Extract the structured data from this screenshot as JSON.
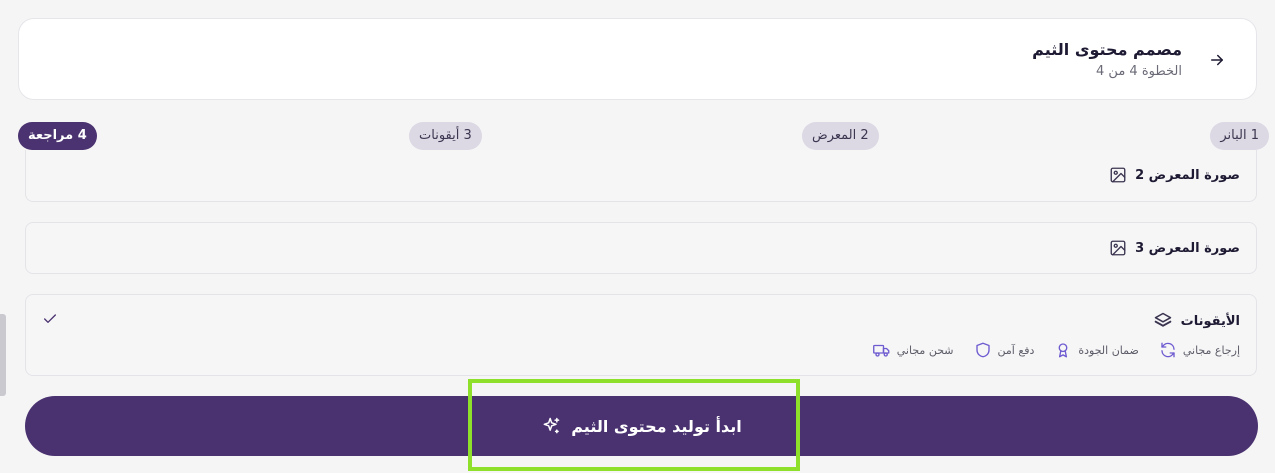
{
  "header": {
    "title": "مصمم محتوى الثيم",
    "step_text": "الخطوة 4 من 4"
  },
  "stepper": {
    "steps": [
      {
        "label": "1 البانر",
        "active": false
      },
      {
        "label": "2 المعرض",
        "active": false
      },
      {
        "label": "3 أيقونات",
        "active": false
      },
      {
        "label": "4 مراجعة",
        "active": true
      }
    ]
  },
  "sections": {
    "gallery_2": {
      "title": "صورة المعرض 2",
      "icon": "image-icon"
    },
    "gallery_3": {
      "title": "صورة المعرض 3",
      "icon": "image-icon"
    },
    "icons": {
      "title": "الأيقونات",
      "icon": "layers-icon",
      "status_icon": "check-icon",
      "features": [
        {
          "label": "شحن مجاني",
          "icon": "truck-icon"
        },
        {
          "label": "دفع آمن",
          "icon": "shield-icon"
        },
        {
          "label": "ضمان الجودة",
          "icon": "award-icon"
        },
        {
          "label": "إرجاع مجاني",
          "icon": "refresh-icon"
        }
      ]
    }
  },
  "generate_button": {
    "label": "ابدأ توليد محتوى الثيم",
    "icon": "sparkles-icon"
  },
  "colors": {
    "primary": "#4a3270",
    "feature_icon": "#6d5bd0",
    "highlight": "#8ee02b"
  }
}
